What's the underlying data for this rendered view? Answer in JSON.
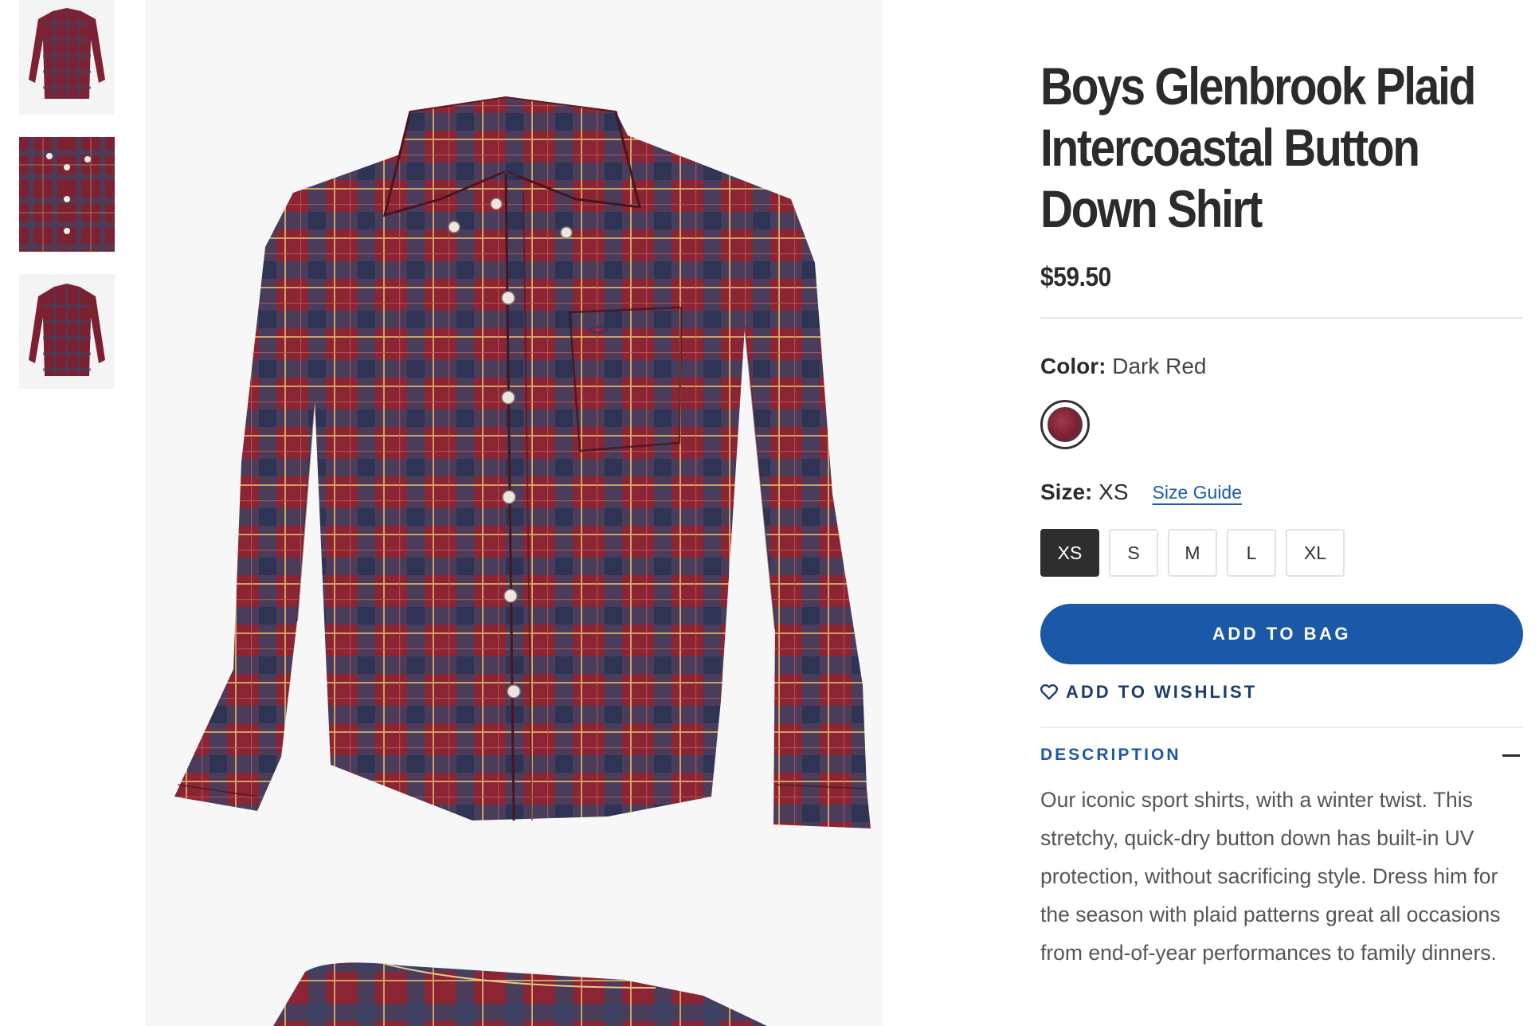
{
  "product": {
    "title": "Boys Glenbrook Plaid Intercoastal Button Down Shirt",
    "price": "$59.50"
  },
  "color": {
    "label": "Color:",
    "value": "Dark Red",
    "swatch_color": "#7a2030"
  },
  "size": {
    "label": "Size:",
    "value": "XS",
    "guide_label": "Size Guide",
    "options": [
      "XS",
      "S",
      "M",
      "L",
      "XL"
    ],
    "selected": "XS"
  },
  "actions": {
    "add_to_bag": "ADD TO BAG",
    "add_to_wishlist": "ADD TO WISHLIST"
  },
  "description": {
    "heading": "DESCRIPTION",
    "text": "Our iconic sport shirts, with a winter twist. This stretchy, quick-dry button down has built-in UV protection, without sacrificing style. Dress him for the season with plaid patterns great all occasions from end-of-year performances to family dinners."
  },
  "colors": {
    "accent": "#1b58a7",
    "dark": "#2e2e2e",
    "shirt_red": "#8b2433",
    "shirt_navy": "#3a4466"
  }
}
